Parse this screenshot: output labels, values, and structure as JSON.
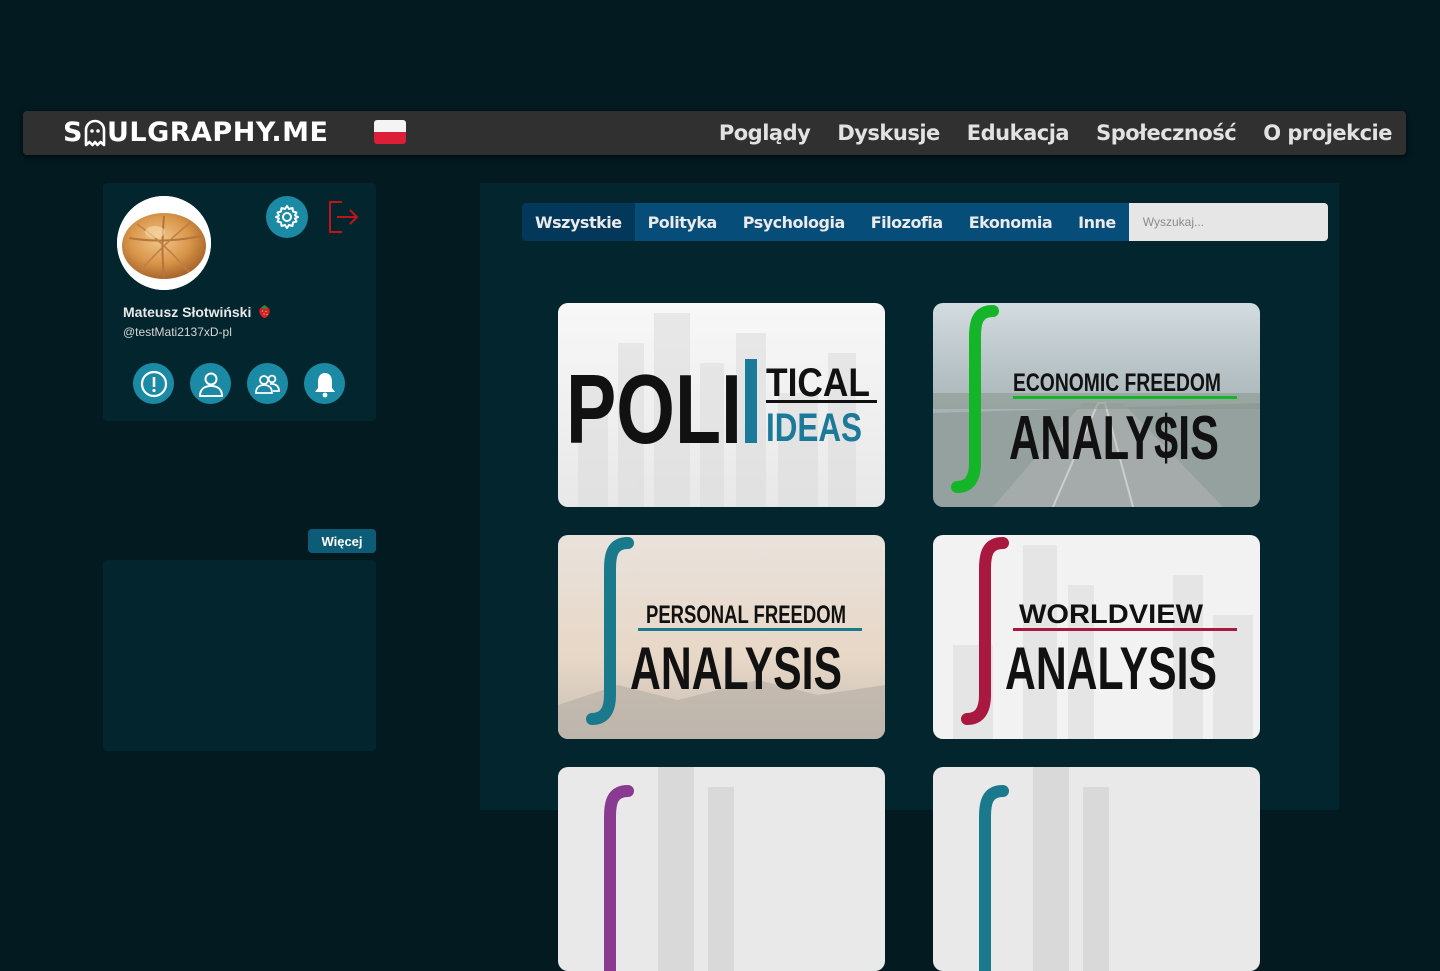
{
  "header": {
    "logo_prefix": "S",
    "logo_suffix": "ULGRAPHY.ME",
    "language_flag": "flag-poland-icon",
    "nav": [
      "Poglądy",
      "Dyskusje",
      "Edukacja",
      "Społeczność",
      "O projekcie"
    ]
  },
  "profile": {
    "name": "Mateusz Słotwiński",
    "badge": "strawberry-icon",
    "handle": "@testMati2137xD-pl",
    "more_label": "Więcej"
  },
  "filters": {
    "tabs": [
      "Wszystkie",
      "Polityka",
      "Psychologia",
      "Filozofia",
      "Ekonomia",
      "Inne"
    ],
    "active": "Wszystkie",
    "search_placeholder": "Wyszukaj..."
  },
  "tests": [
    {
      "line1": "POLI",
      "line2": "TICAL",
      "line3": "IDEAS"
    },
    {
      "line1": "ECONOMIC FREEDOM",
      "line2": "ANALY$IS"
    },
    {
      "line1": "PERSONAL FREEDOM",
      "line2": "ANALYSIS"
    },
    {
      "line1": "WORLDVIEW",
      "line2": "ANALYSIS"
    }
  ],
  "colors": {
    "background": "#021a20",
    "panel": "#03252e",
    "accent": "#1a8aa5",
    "tab": "#074d79",
    "economic": "#15b52a",
    "personal": "#1a7a8c",
    "worldview": "#a8183f"
  }
}
